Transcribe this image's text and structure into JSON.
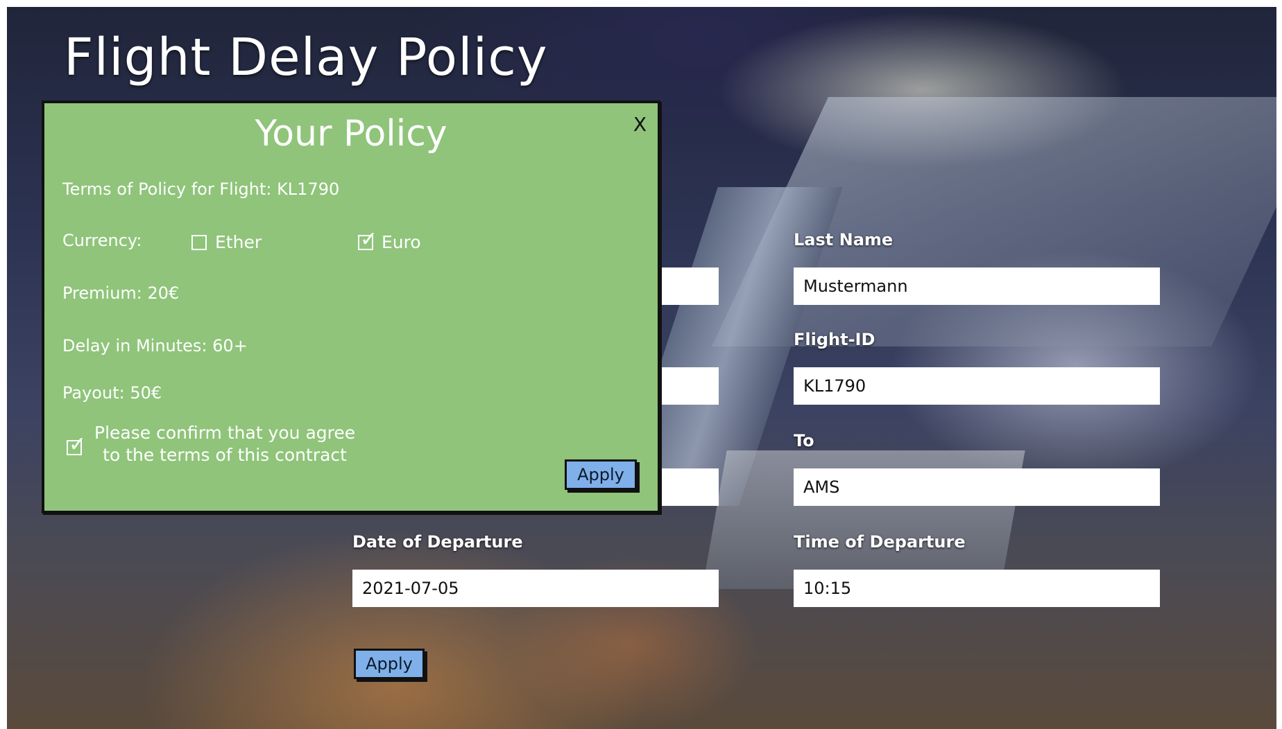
{
  "page": {
    "title": "Flight Delay Policy"
  },
  "form": {
    "last_name_label": "Last Name",
    "last_name_value": "Mustermann",
    "flight_id_label": "Flight-ID",
    "flight_id_value": "KL1790",
    "to_label": "To",
    "to_value": "AMS",
    "date_label": "Date of Departure",
    "date_value": "2021-07-05",
    "time_label": "Time of Departure",
    "time_value": "10:15",
    "apply_label": "Apply"
  },
  "modal": {
    "title": "Your Policy",
    "close_label": "X",
    "terms_text": "Terms of Policy for Flight: KL1790",
    "currency_label": "Currency:",
    "currency_options": [
      {
        "label": "Ether",
        "checked": false
      },
      {
        "label": "Euro",
        "checked": true
      }
    ],
    "premium_text": "Premium: 20€",
    "delay_text": "Delay in Minutes: 60+",
    "payout_text": "Payout: 50€",
    "agree_line1": "Please confirm that you agree",
    "agree_line2": "to the terms of this contract",
    "agree_checked": true,
    "apply_label": "Apply"
  },
  "colors": {
    "modal_bg": "#8fc47a",
    "button_bg": "#7fb0ea"
  },
  "icons": {
    "checkbox_checked": "check-icon",
    "close": "close-icon"
  }
}
